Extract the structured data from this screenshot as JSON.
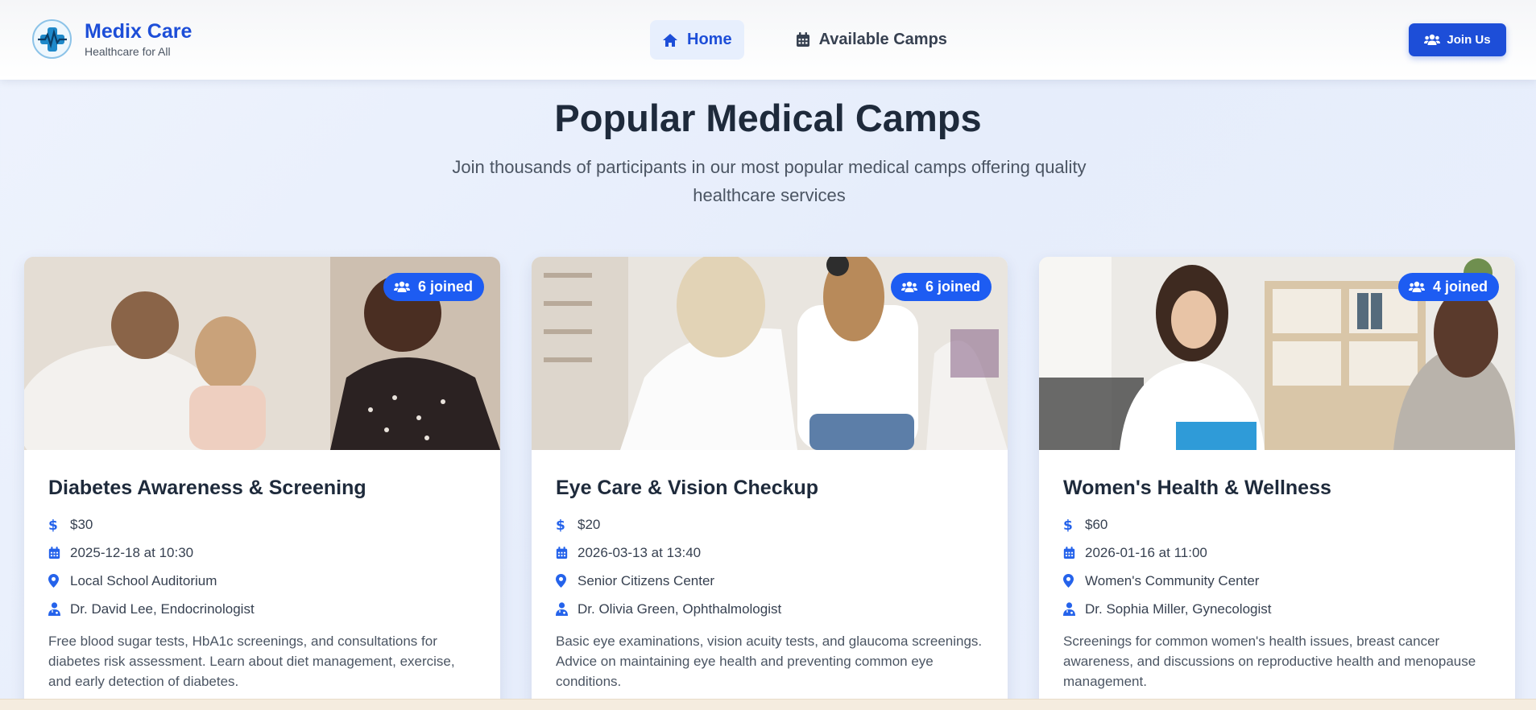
{
  "brand": {
    "name": "Medix Care",
    "tagline": "Healthcare for All",
    "logo_icon": "medical-cross-pulse-icon"
  },
  "nav": [
    {
      "label": "Home",
      "icon": "home-icon",
      "active": true
    },
    {
      "label": "Available Camps",
      "icon": "calendar-icon",
      "active": false
    }
  ],
  "join_button": {
    "label": "Join Us",
    "icon": "users-icon"
  },
  "hero": {
    "title": "Popular Medical Camps",
    "subtitle": "Join thousands of participants in our most popular medical camps offering quality healthcare services"
  },
  "colors": {
    "accent": "#1d4ed8",
    "badge": "#1d5cf2",
    "icon": "#2563eb"
  },
  "camps": [
    {
      "joined": "6 joined",
      "title": "Diabetes Awareness & Screening",
      "fee": "$30",
      "datetime": "2025-12-18 at 10:30",
      "location": "Local School Auditorium",
      "doctor": "Dr. David Lee, Endocrinologist",
      "description": "Free blood sugar tests, HbA1c screenings, and consultations for diabetes risk assessment. Learn about diet management, exercise, and early detection of diabetes."
    },
    {
      "joined": "6 joined",
      "title": "Eye Care & Vision Checkup",
      "fee": "$20",
      "datetime": "2026-03-13 at 13:40",
      "location": "Senior Citizens Center",
      "doctor": "Dr. Olivia Green, Ophthalmologist",
      "description": "Basic eye examinations, vision acuity tests, and glaucoma screenings. Advice on maintaining eye health and preventing common eye conditions."
    },
    {
      "joined": "4 joined",
      "title": "Women's Health & Wellness",
      "fee": "$60",
      "datetime": "2026-01-16 at 11:00",
      "location": "Women's Community Center",
      "doctor": "Dr. Sophia Miller, Gynecologist",
      "description": "Screenings for common women's health issues, breast cancer awareness, and discussions on reproductive health and menopause management."
    }
  ]
}
